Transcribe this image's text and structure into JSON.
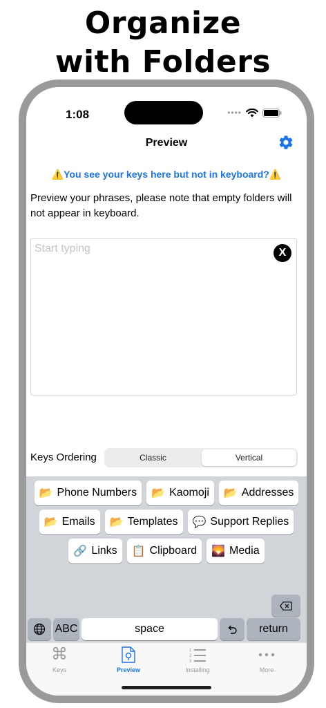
{
  "headline": {
    "line1": "Organize",
    "line2": "with Folders"
  },
  "status_bar": {
    "time": "1:08",
    "carrier_dots": "••••"
  },
  "nav": {
    "title": "Preview",
    "settings_icon": "gear-icon"
  },
  "warning": {
    "icon_left": "⚠️",
    "text": "You see your keys here but not in keyboard?",
    "icon_right": "⚠️"
  },
  "description": "Preview your phrases, please note that empty folders will not appear in keyboard.",
  "input": {
    "placeholder": "Start typing",
    "clear_label": "X"
  },
  "ordering": {
    "label": "Keys Ordering",
    "options": [
      "Classic",
      "Vertical"
    ],
    "selected": "Vertical"
  },
  "keyboard": {
    "rows": [
      [
        {
          "icon": "📂",
          "label": "Phone Numbers"
        },
        {
          "icon": "📂",
          "label": "Kaomoji"
        },
        {
          "icon": "📂",
          "label": "Addresses"
        }
      ],
      [
        {
          "icon": "📂",
          "label": "Emails"
        },
        {
          "icon": "📂",
          "label": "Templates"
        },
        {
          "icon": "💬",
          "label": "Support Replies"
        }
      ],
      [
        {
          "icon": "🔗",
          "label": "Links"
        },
        {
          "icon": "📋",
          "label": "Clipboard"
        },
        {
          "icon": "🌄",
          "label": "Media"
        }
      ]
    ],
    "abc_label": "ABC",
    "space_label": "space",
    "return_label": "return"
  },
  "tabbar": {
    "tabs": [
      {
        "label": "Keys",
        "icon": "command-icon"
      },
      {
        "label": "Preview",
        "icon": "document-icon"
      },
      {
        "label": "Installing",
        "icon": "numbered-list-icon"
      },
      {
        "label": "More",
        "icon": "more-dots-icon"
      }
    ],
    "active": "Preview"
  },
  "colors": {
    "accent": "#1a73e8",
    "frame": "#9a9a9a",
    "keyboard_bg": "#d1d4d9"
  }
}
